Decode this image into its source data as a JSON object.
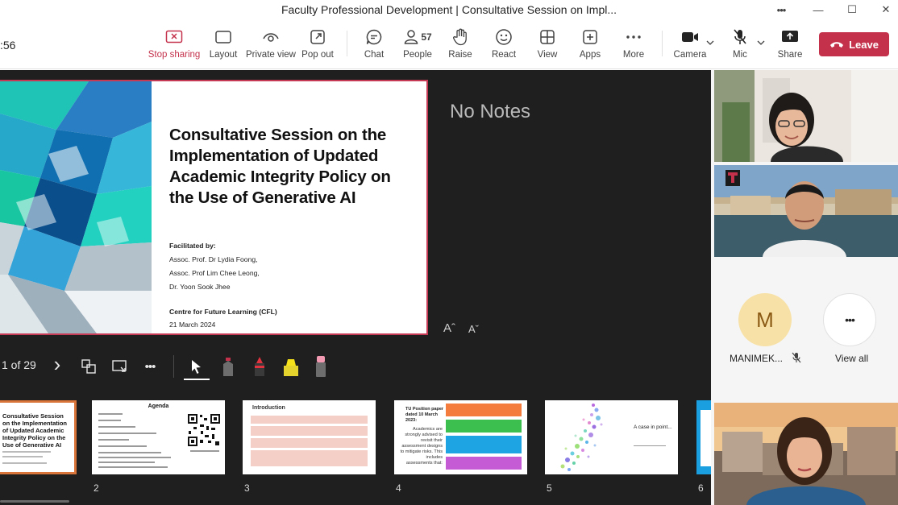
{
  "window": {
    "title": "Faculty Professional Development | Consultative Session on Impl...",
    "more_glyph": "•••",
    "minimize_glyph": "—",
    "maximize_glyph": "☐",
    "close_glyph": "✕"
  },
  "toolbar": {
    "timer": ":56",
    "stop_sharing": "Stop sharing",
    "layout": "Layout",
    "private_view": "Private view",
    "pop_out": "Pop out",
    "chat": "Chat",
    "people": "People",
    "people_count": "57",
    "raise": "Raise",
    "react": "React",
    "view": "View",
    "apps": "Apps",
    "more": "More",
    "camera": "Camera",
    "mic": "Mic",
    "share": "Share",
    "leave": "Leave"
  },
  "slide": {
    "title": "Consultative Session on the Implementation of Updated Academic Integrity Policy on the Use of Generative AI",
    "facilitated_by": "Facilitated by:",
    "facilitators": [
      "Assoc. Prof. Dr Lydia Foong,",
      "Assoc. Prof Lim Chee Leong,",
      "Dr. Yoon Sook Jhee"
    ],
    "centre": "Centre for Future Learning (CFL)",
    "date": "21 March 2024"
  },
  "notes": "No Notes",
  "font_controls": {
    "increase": "Aˆ",
    "decrease": "Aˇ"
  },
  "slideshow": {
    "page": "1 of 29",
    "next_glyph": "›",
    "more_glyph": "•••"
  },
  "thumbnails": [
    {
      "num": "",
      "title": "Consultative Session on the Implementation of Updated Academic Integrity Policy on the Use of Generative AI"
    },
    {
      "num": "2",
      "title": "Agenda"
    },
    {
      "num": "3",
      "title": "Introduction"
    },
    {
      "num": "4",
      "title": "TU Position paper dated 10 March 2023:",
      "body": "Academics are strongly advised to revisit their assessment designs to mitigate risks. This includes assessments that:"
    },
    {
      "num": "5",
      "title": "A case in point..."
    },
    {
      "num": "6",
      "title": ""
    }
  ],
  "participants": [
    {
      "name": "MANIMEK...",
      "initial": "M",
      "muted_glyph": "🎙"
    },
    {
      "name": "View all",
      "glyph": "•••"
    }
  ],
  "colors": {
    "accent_red": "#c4314b",
    "slide_border": "#c73a55",
    "stage_bg": "#1f1f1f",
    "avatar_bg": "#f7e1a6",
    "avatar_text": "#8a5a14"
  }
}
